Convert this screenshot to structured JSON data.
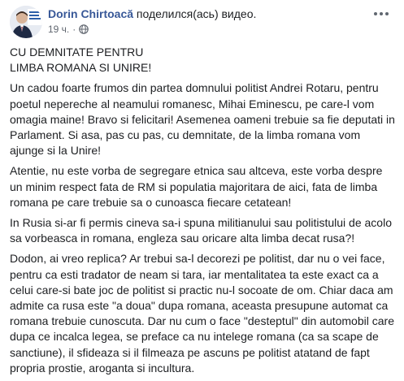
{
  "post": {
    "author": "Dorin Chirtoacă",
    "action": "поделился(ась) видео.",
    "time": "19 ч.",
    "separator": "·",
    "avatar_text": "Partidul Liberal",
    "title_lines": [
      "CU DEMNITATE PENTRU",
      "LIMBA ROMANA SI UNIRE!"
    ],
    "paragraphs": [
      "Un cadou foarte frumos din partea domnului politist Andrei Rotaru, pentru poetul nepereche al neamului romanesc, Mihai Eminescu, pe care-l vom omagia maine! Bravo si felicitari! Asemenea oameni trebuie sa fie deputati in Parlament. Si asa, pas cu pas, cu demnitate, de la limba romana vom ajunge si la Unire!",
      "Atentie, nu este vorba de segregare etnica sau altceva, este vorba despre un minim respect fata de RM si populatia majoritara de aici, fata de limba romana pe care trebuie sa o cunoasca fiecare cetatean!",
      "In Rusia si-ar fi permis cineva sa-i spuna militianului sau politistului de acolo sa vorbeasca in romana, engleza sau oricare alta limba decat rusa?!",
      "Dodon, ai vreo replica? Ar trebui sa-l decorezi pe politist, dar nu o vei face, pentru ca esti tradator de neam si tara, iar mentalitatea ta este exact ca a celui care-si bate joc de politist si practic nu-l socoate de om. Chiar daca am admite ca rusa este \"a doua\" dupa romana, aceasta presupune automat ca romana trebuie cunoscuta. Dar nu cum o face \"desteptul\" din automobil care dupa ce incalca legea, se preface ca nu intelege romana (ca sa scape de sanctiune), il sfideaza si il filmeaza pe ascuns pe politist atatand de fapt propria prostie, aroganta si incultura."
    ]
  },
  "colors": {
    "author": "#385898",
    "text": "#1c1e21",
    "meta": "#616770"
  },
  "icons": [
    "avatar",
    "globe-icon",
    "more-options-icon"
  ]
}
